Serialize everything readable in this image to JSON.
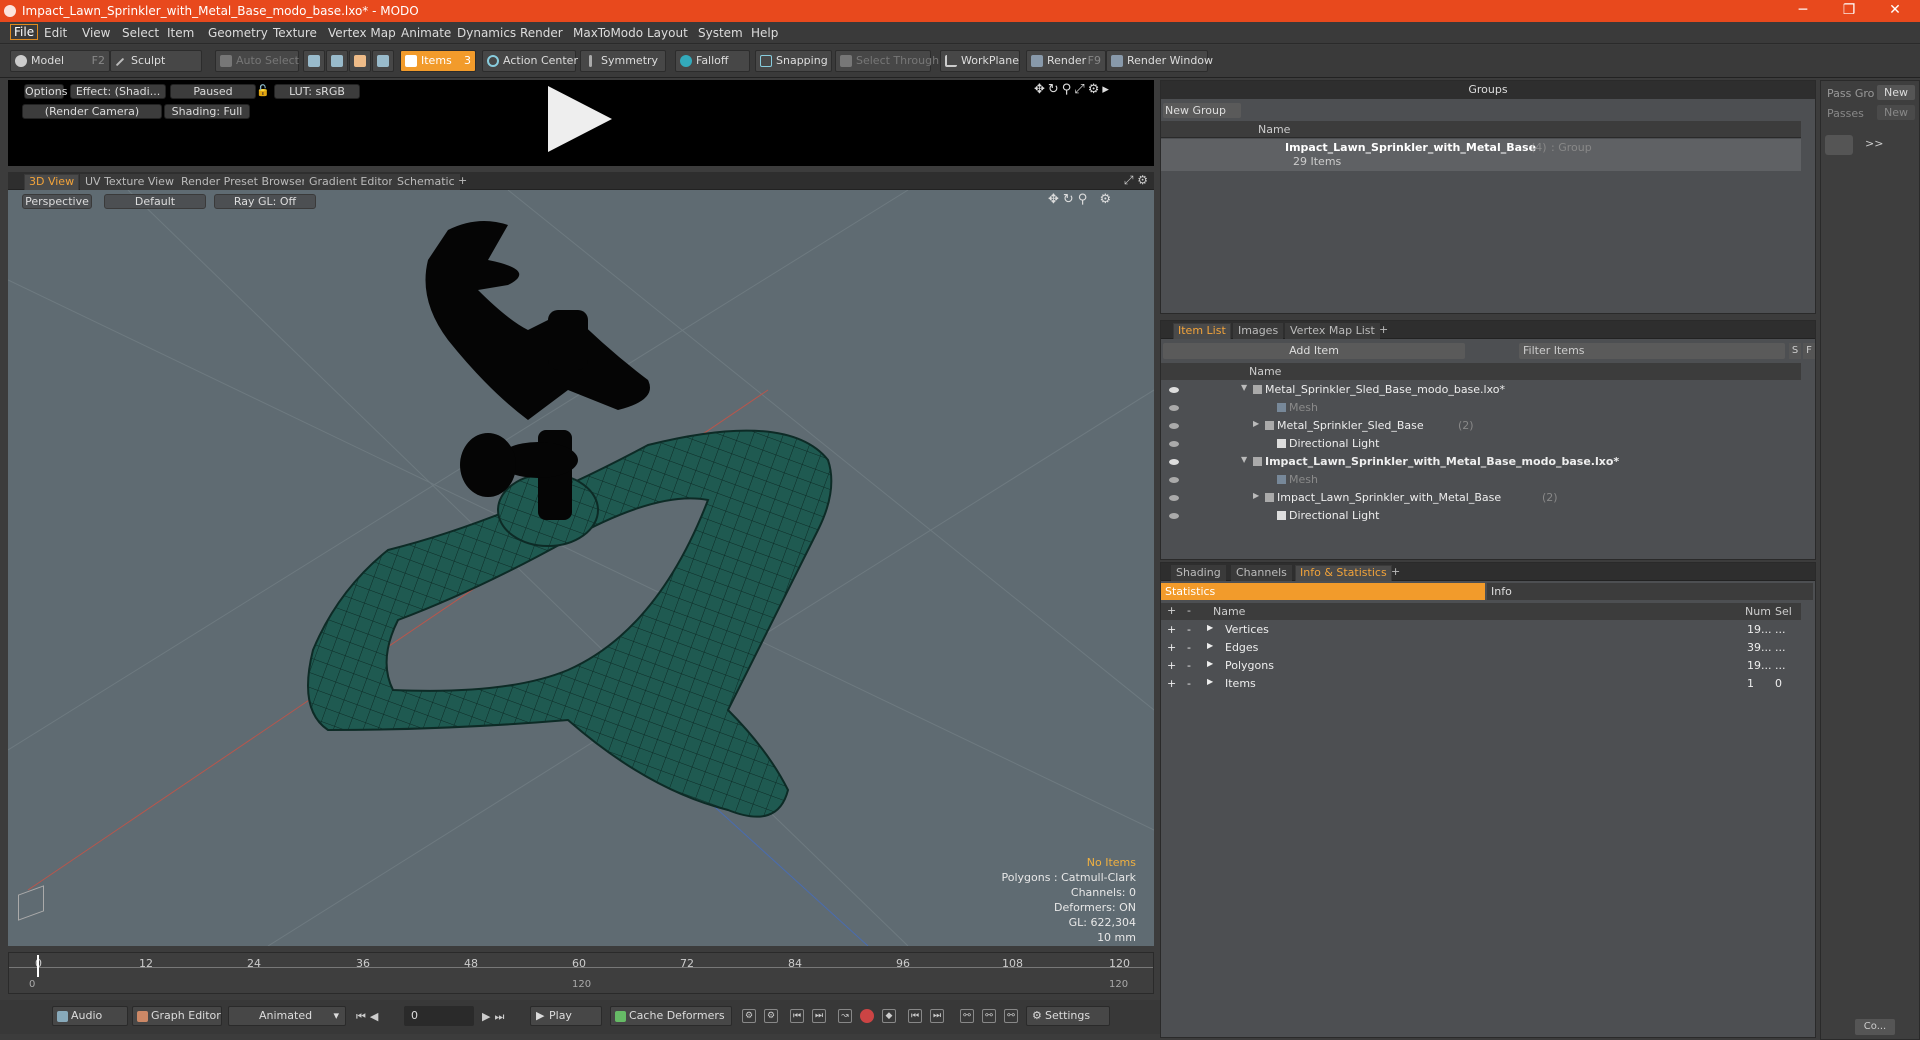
{
  "window": {
    "title": "Impact_Lawn_Sprinkler_with_Metal_Base_modo_base.lxo* - MODO",
    "min": "─",
    "max": "❐",
    "close": "✕"
  },
  "menu": [
    "File",
    "Edit",
    "View",
    "Select",
    "Item",
    "Geometry",
    "Texture",
    "Vertex Map",
    "Animate",
    "Dynamics",
    "Render",
    "MaxToModo",
    "Layout",
    "System",
    "Help"
  ],
  "toolbar": {
    "model": "Model",
    "model_key": "F2",
    "sculpt": "Sculpt",
    "auto_select": "Auto Select",
    "items": "Items",
    "items_key": "3",
    "action_center": "Action Center",
    "symmetry": "Symmetry",
    "falloff": "Falloff",
    "snapping": "Snapping",
    "select_through": "Select Through",
    "workplane": "WorkPlane",
    "render": "Render",
    "render_key": "F9",
    "render_window": "Render Window"
  },
  "preview": {
    "options": "Options",
    "effect": "Effect: (Shadi...",
    "paused": "Paused",
    "lut": "LUT: sRGB",
    "camera": "(Render Camera)",
    "shading": "Shading: Full"
  },
  "view_tabs": [
    "3D View",
    "UV Texture View",
    "Render Preset Browser",
    "Gradient Editor",
    "Schematic",
    "+"
  ],
  "viewport": {
    "perspective": "Perspective",
    "default": "Default",
    "raygl": "Ray GL: Off",
    "no_items": "No Items",
    "polygons": "Polygons : Catmull-Clark",
    "channels": "Channels: 0",
    "deformers": "Deformers: ON",
    "gl": "GL: 622,304",
    "scale": "10 mm"
  },
  "timeline": {
    "ticks": [
      "0",
      "12",
      "24",
      "36",
      "48",
      "60",
      "72",
      "84",
      "96",
      "108",
      "120"
    ],
    "lower": [
      "0",
      "120",
      "120"
    ]
  },
  "bottom": {
    "audio": "Audio",
    "graph_editor": "Graph Editor",
    "animated": "Animated",
    "frame": "0",
    "play": "Play",
    "cache": "Cache Deformers",
    "settings": "Settings"
  },
  "groups": {
    "title": "Groups",
    "new_group": "New Group",
    "col_name": "Name",
    "item": "Impact_Lawn_Sprinkler_with_Metal_Base",
    "item_count": "(4)",
    "item_type": ": Group",
    "item_sub": "29 Items"
  },
  "far_right": {
    "pass_group": "Pass Gro",
    "new1": "New",
    "passes": "Passes",
    "new2": "New",
    "more": ">>",
    "co": "Co..."
  },
  "itemlist": {
    "tabs": [
      "Item List",
      "Images",
      "Vertex Map List",
      "+"
    ],
    "add_item": "Add Item",
    "filter": "Filter Items",
    "s": "S",
    "f": "F",
    "col_name": "Name",
    "rows": [
      {
        "label": "Metal_Sprinkler_Sled_Base_modo_base.lxo*",
        "indent": 0,
        "arrow": "▼",
        "bold": false,
        "ghost": false
      },
      {
        "label": "Mesh",
        "indent": 2,
        "arrow": "",
        "bold": false,
        "ghost": true
      },
      {
        "label": "Metal_Sprinkler_Sled_Base",
        "indent": 1,
        "arrow": "▶",
        "bold": false,
        "ghost": false,
        "count": "(2)"
      },
      {
        "label": "Directional Light",
        "indent": 2,
        "arrow": "",
        "bold": false,
        "ghost": false
      },
      {
        "label": "Impact_Lawn_Sprinkler_with_Metal_Base_modo_base.lxo*",
        "indent": 0,
        "arrow": "▼",
        "bold": true,
        "ghost": false
      },
      {
        "label": "Mesh",
        "indent": 2,
        "arrow": "",
        "bold": false,
        "ghost": true
      },
      {
        "label": "Impact_Lawn_Sprinkler_with_Metal_Base",
        "indent": 1,
        "arrow": "▶",
        "bold": false,
        "ghost": false,
        "count": "(2)"
      },
      {
        "label": "Directional Light",
        "indent": 2,
        "arrow": "",
        "bold": false,
        "ghost": false
      }
    ]
  },
  "stats": {
    "tabs": [
      "Shading",
      "Channels",
      "Info & Statistics",
      "+"
    ],
    "statistics": "Statistics",
    "info": "Info",
    "col_name": "Name",
    "col_num": "Num",
    "col_sel": "Sel",
    "rows": [
      {
        "label": "Vertices",
        "num": "19...",
        "sel": "..."
      },
      {
        "label": "Edges",
        "num": "39...",
        "sel": "..."
      },
      {
        "label": "Polygons",
        "num": "19...",
        "sel": "..."
      },
      {
        "label": "Items",
        "num": "1",
        "sel": "0"
      }
    ]
  },
  "colors": {
    "accent": "#f29b2b",
    "title": "#e8491d",
    "mesh": "#1f5a51",
    "viewport": "#5f6b72"
  }
}
